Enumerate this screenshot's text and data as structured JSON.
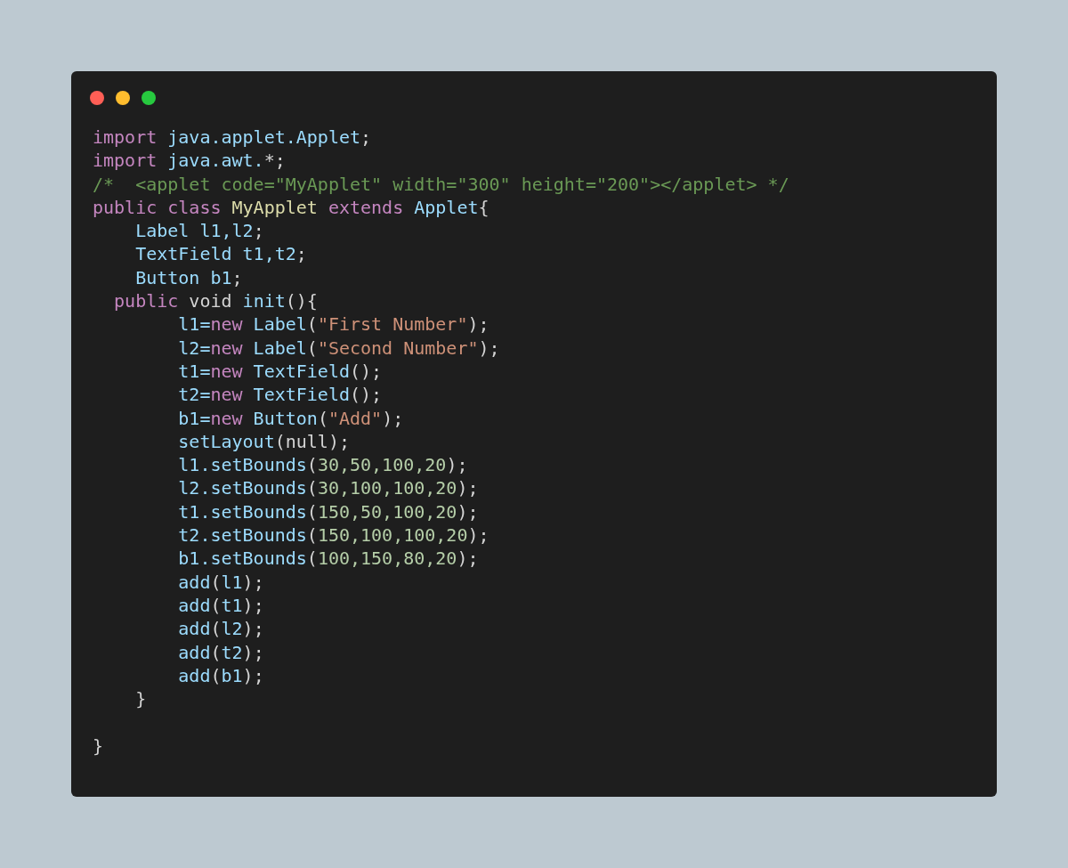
{
  "window": {
    "controls": [
      {
        "color": "#ff5f56"
      },
      {
        "color": "#ffbd2e"
      },
      {
        "color": "#27c93f"
      }
    ]
  },
  "code": {
    "lines": [
      {
        "kind": "code",
        "tokens": [
          {
            "kind": "keyword",
            "text": "import"
          },
          {
            "kind": "ident",
            "text": " java.applet.Applet"
          },
          {
            "kind": "plain",
            "text": ";"
          }
        ]
      },
      {
        "kind": "code",
        "tokens": [
          {
            "kind": "keyword",
            "text": "import"
          },
          {
            "kind": "ident",
            "text": " java.awt."
          },
          {
            "kind": "plain",
            "text": "*;"
          }
        ]
      },
      {
        "kind": "code",
        "tokens": [
          {
            "kind": "comment",
            "text": "/*  <applet code=\"MyApplet\" width=\"300\" height=\"200\"></applet> */"
          }
        ]
      },
      {
        "kind": "code",
        "tokens": [
          {
            "kind": "keyword",
            "text": "public class"
          },
          {
            "kind": "classname",
            "text": " MyApplet"
          },
          {
            "kind": "keyword",
            "text": " extends"
          },
          {
            "kind": "ident",
            "text": " Applet"
          },
          {
            "kind": "plain",
            "text": "{"
          }
        ]
      },
      {
        "kind": "code",
        "tokens": [
          {
            "kind": "ident",
            "text": "    Label l1,l2"
          },
          {
            "kind": "plain",
            "text": ";"
          }
        ]
      },
      {
        "kind": "code",
        "tokens": [
          {
            "kind": "ident",
            "text": "    TextField t1,t2"
          },
          {
            "kind": "plain",
            "text": ";"
          }
        ]
      },
      {
        "kind": "code",
        "tokens": [
          {
            "kind": "ident",
            "text": "    Button b1"
          },
          {
            "kind": "plain",
            "text": ";"
          }
        ]
      },
      {
        "kind": "code",
        "tokens": [
          {
            "kind": "keyword",
            "text": "  public"
          },
          {
            "kind": "plain",
            "text": " void"
          },
          {
            "kind": "ident",
            "text": " init"
          },
          {
            "kind": "plain",
            "text": "(){"
          }
        ]
      },
      {
        "kind": "code",
        "tokens": [
          {
            "kind": "ident",
            "text": "        l1="
          },
          {
            "kind": "keyword",
            "text": "new"
          },
          {
            "kind": "ident",
            "text": " Label"
          },
          {
            "kind": "plain",
            "text": "("
          },
          {
            "kind": "string",
            "text": "\"First Number\""
          },
          {
            "kind": "plain",
            "text": ");"
          }
        ]
      },
      {
        "kind": "code",
        "tokens": [
          {
            "kind": "ident",
            "text": "        l2="
          },
          {
            "kind": "keyword",
            "text": "new"
          },
          {
            "kind": "ident",
            "text": " Label"
          },
          {
            "kind": "plain",
            "text": "("
          },
          {
            "kind": "string",
            "text": "\"Second Number\""
          },
          {
            "kind": "plain",
            "text": ");"
          }
        ]
      },
      {
        "kind": "code",
        "tokens": [
          {
            "kind": "ident",
            "text": "        t1="
          },
          {
            "kind": "keyword",
            "text": "new"
          },
          {
            "kind": "ident",
            "text": " TextField"
          },
          {
            "kind": "plain",
            "text": "();"
          }
        ]
      },
      {
        "kind": "code",
        "tokens": [
          {
            "kind": "ident",
            "text": "        t2="
          },
          {
            "kind": "keyword",
            "text": "new"
          },
          {
            "kind": "ident",
            "text": " TextField"
          },
          {
            "kind": "plain",
            "text": "();"
          }
        ]
      },
      {
        "kind": "code",
        "tokens": [
          {
            "kind": "ident",
            "text": "        b1="
          },
          {
            "kind": "keyword",
            "text": "new"
          },
          {
            "kind": "ident",
            "text": " Button"
          },
          {
            "kind": "plain",
            "text": "("
          },
          {
            "kind": "string",
            "text": "\"Add\""
          },
          {
            "kind": "plain",
            "text": ");"
          }
        ]
      },
      {
        "kind": "code",
        "tokens": [
          {
            "kind": "ident",
            "text": "        setLayout"
          },
          {
            "kind": "plain",
            "text": "(null);"
          }
        ]
      },
      {
        "kind": "code",
        "tokens": [
          {
            "kind": "ident",
            "text": "        l1.setBounds"
          },
          {
            "kind": "plain",
            "text": "("
          },
          {
            "kind": "number",
            "text": "30,50,100,20"
          },
          {
            "kind": "plain",
            "text": ");"
          }
        ]
      },
      {
        "kind": "code",
        "tokens": [
          {
            "kind": "ident",
            "text": "        l2.setBounds"
          },
          {
            "kind": "plain",
            "text": "("
          },
          {
            "kind": "number",
            "text": "30,100,100,20"
          },
          {
            "kind": "plain",
            "text": ");"
          }
        ]
      },
      {
        "kind": "code",
        "tokens": [
          {
            "kind": "ident",
            "text": "        t1.setBounds"
          },
          {
            "kind": "plain",
            "text": "("
          },
          {
            "kind": "number",
            "text": "150,50,100,20"
          },
          {
            "kind": "plain",
            "text": ");"
          }
        ]
      },
      {
        "kind": "code",
        "tokens": [
          {
            "kind": "ident",
            "text": "        t2.setBounds"
          },
          {
            "kind": "plain",
            "text": "("
          },
          {
            "kind": "number",
            "text": "150,100,100,20"
          },
          {
            "kind": "plain",
            "text": ");"
          }
        ]
      },
      {
        "kind": "code",
        "tokens": [
          {
            "kind": "ident",
            "text": "        b1.setBounds"
          },
          {
            "kind": "plain",
            "text": "("
          },
          {
            "kind": "number",
            "text": "100,150,80,20"
          },
          {
            "kind": "plain",
            "text": ");"
          }
        ]
      },
      {
        "kind": "code",
        "tokens": [
          {
            "kind": "ident",
            "text": "        add"
          },
          {
            "kind": "plain",
            "text": "("
          },
          {
            "kind": "ident",
            "text": "l1"
          },
          {
            "kind": "plain",
            "text": ");"
          }
        ]
      },
      {
        "kind": "code",
        "tokens": [
          {
            "kind": "ident",
            "text": "        add"
          },
          {
            "kind": "plain",
            "text": "("
          },
          {
            "kind": "ident",
            "text": "t1"
          },
          {
            "kind": "plain",
            "text": ");"
          }
        ]
      },
      {
        "kind": "code",
        "tokens": [
          {
            "kind": "ident",
            "text": "        add"
          },
          {
            "kind": "plain",
            "text": "("
          },
          {
            "kind": "ident",
            "text": "l2"
          },
          {
            "kind": "plain",
            "text": ");"
          }
        ]
      },
      {
        "kind": "code",
        "tokens": [
          {
            "kind": "ident",
            "text": "        add"
          },
          {
            "kind": "plain",
            "text": "("
          },
          {
            "kind": "ident",
            "text": "t2"
          },
          {
            "kind": "plain",
            "text": ");"
          }
        ]
      },
      {
        "kind": "code",
        "tokens": [
          {
            "kind": "ident",
            "text": "        add"
          },
          {
            "kind": "plain",
            "text": "("
          },
          {
            "kind": "ident",
            "text": "b1"
          },
          {
            "kind": "plain",
            "text": ");"
          }
        ]
      },
      {
        "kind": "code",
        "tokens": [
          {
            "kind": "plain",
            "text": "    }"
          }
        ]
      },
      {
        "kind": "blank"
      },
      {
        "kind": "code",
        "tokens": [
          {
            "kind": "plain",
            "text": "}"
          }
        ]
      }
    ]
  }
}
